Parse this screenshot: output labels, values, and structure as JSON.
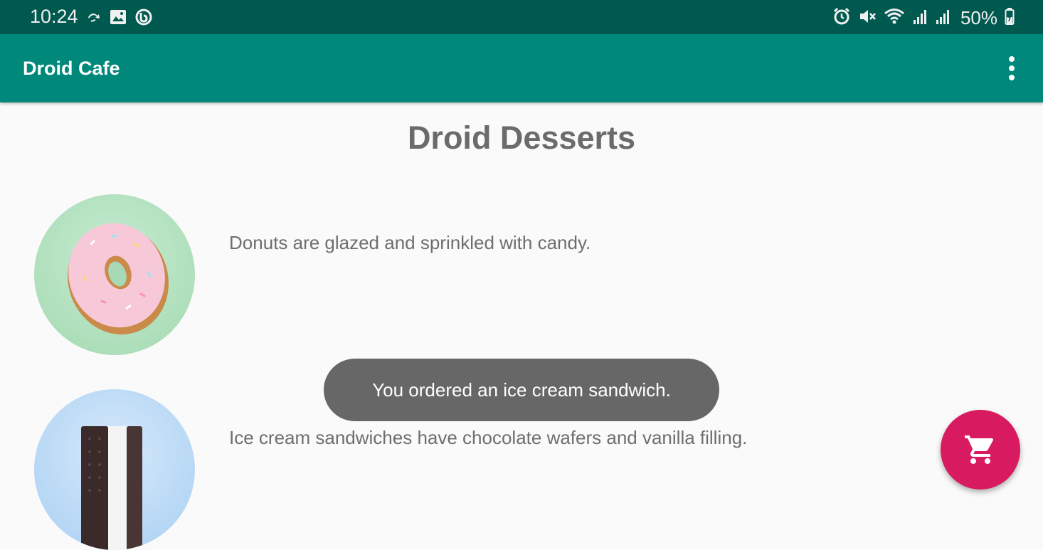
{
  "status_bar": {
    "time": "10:24",
    "battery": "50%",
    "icons_left": [
      "sync-icon",
      "image-icon",
      "call-app-icon"
    ],
    "icons_right": [
      "alarm-icon",
      "mute-icon",
      "wifi-icon",
      "signal-icon",
      "signal-icon",
      "battery-icon"
    ]
  },
  "app_bar": {
    "title": "Droid Cafe",
    "overflow_icon": "more-vert-icon"
  },
  "main": {
    "title": "Droid Desserts",
    "items": [
      {
        "name": "donut",
        "description": "Donuts are glazed and sprinkled with candy."
      },
      {
        "name": "ice cream sandwich",
        "description": "Ice cream sandwiches have chocolate wafers and vanilla filling."
      }
    ]
  },
  "toast": {
    "message": "You ordered an ice cream sandwich."
  },
  "fab": {
    "icon": "shopping-cart-icon",
    "color": "#d81b60"
  },
  "colors": {
    "status_bar": "#00594f",
    "app_bar": "#00897b",
    "accent": "#d81b60"
  }
}
